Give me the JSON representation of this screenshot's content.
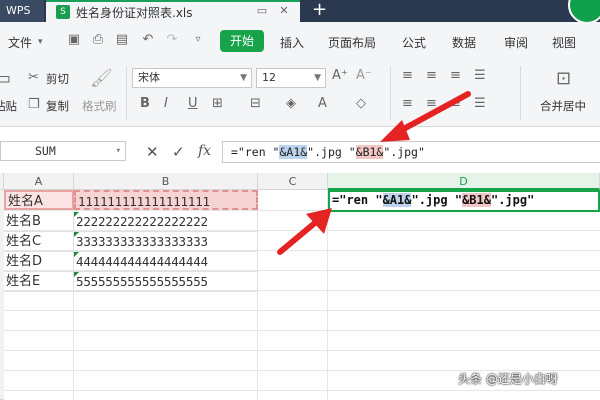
{
  "tabs": {
    "wps": "WPS",
    "file_name": "姓名身份证对照表.xls",
    "file_icon": "S",
    "add": "+"
  },
  "menu": {
    "file": "文件",
    "start": "开始",
    "items": [
      "插入",
      "页面布局",
      "公式",
      "数据",
      "审阅",
      "视图"
    ]
  },
  "ribbon": {
    "cut": "剪切",
    "copy": "复制",
    "format_painter": "格式刷",
    "paste_partial": "粘贴",
    "font": "宋体",
    "font_size": "12",
    "merge_center": "合并居中",
    "bold": "B",
    "italic": "I",
    "underline": "U"
  },
  "formula_bar": {
    "name_box": "SUM",
    "fx": "fx",
    "formula_parts": [
      "=\"ren \"",
      "&A1&",
      "\".jpg \"",
      "&B1&",
      "\".jpg\""
    ]
  },
  "sheet": {
    "columns": [
      "A",
      "B",
      "C",
      "D"
    ],
    "rows": [
      {
        "a": "姓名A",
        "b": "111111111111111111"
      },
      {
        "a": "姓名B",
        "b": "222222222222222222"
      },
      {
        "a": "姓名C",
        "b": "333333333333333333"
      },
      {
        "a": "姓名D",
        "b": "444444444444444444"
      },
      {
        "a": "姓名E",
        "b": "555555555555555555"
      }
    ],
    "d1_parts": [
      "=\"ren \"",
      "&A1&",
      "\".jpg \"",
      "&B1&",
      "\".jpg\""
    ]
  },
  "colors": {
    "accent_green": "#16a349",
    "arrow_red": "#e52323",
    "ref_blue": "#bcd3ee",
    "ref_red": "#f3c6c6"
  },
  "watermark": "头条 @还是小白呀"
}
